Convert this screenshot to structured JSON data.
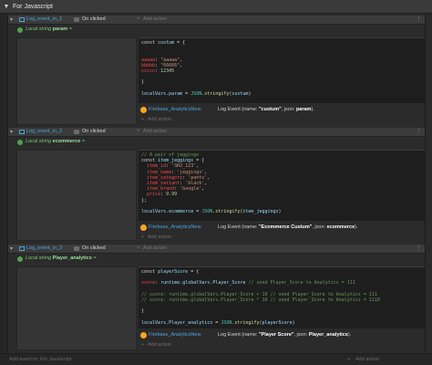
{
  "group": {
    "title": "For Javascript",
    "chevron": "▼"
  },
  "events": [
    {
      "name": "Log_event_in_1",
      "condition": "On clicked",
      "add_action": "Add action",
      "local_var": {
        "prefix": "Local string",
        "name": "param",
        "eq": "="
      },
      "code": [
        [
          [
            "kw",
            "const "
          ],
          [
            "var",
            "custum"
          ],
          [
            "kw",
            " = {"
          ]
        ],
        [
          [
            "kw",
            ""
          ]
        ],
        [
          [
            "kw",
            ""
          ]
        ],
        [
          [
            "red",
            "aaaaa"
          ],
          [
            "kw",
            ": "
          ],
          [
            "str",
            "\"aaaaa\""
          ],
          [
            "kw",
            ","
          ]
        ],
        [
          [
            "red",
            "bbbbb"
          ],
          [
            "kw",
            ": "
          ],
          [
            "str",
            "\"66666\""
          ],
          [
            "kw",
            ","
          ]
        ],
        [
          [
            "red",
            "ccccc"
          ],
          [
            "kw",
            ": "
          ],
          [
            "num",
            "12345"
          ]
        ],
        [
          [
            "kw",
            ""
          ]
        ],
        [
          [
            "kw",
            "}"
          ]
        ],
        [
          [
            "kw",
            ""
          ]
        ],
        [
          [
            "var",
            "localVars"
          ],
          [
            "kw",
            "."
          ],
          [
            "var",
            "param"
          ],
          [
            "kw",
            " = "
          ],
          [
            "prop",
            "JSON"
          ],
          [
            "kw",
            "."
          ],
          [
            "fn",
            "stringify"
          ],
          [
            "kw",
            "("
          ],
          [
            "var",
            "custum"
          ],
          [
            "kw",
            ")"
          ]
        ]
      ],
      "action": {
        "object": "Firebase_AnalyticsNew",
        "text": "Log Event (name: ",
        "bold1": "\"custum\"",
        "mid": ", json: ",
        "bold2": "param",
        "end": ")."
      },
      "add_action_bottom": "Add action"
    },
    {
      "name": "Log_event_in_2",
      "condition": "On clicked",
      "add_action": "Add action",
      "local_var": {
        "prefix": "Local string",
        "name": "ecommerce",
        "eq": "="
      },
      "code": [
        [
          [
            "cmt",
            "// A pair of jeggings"
          ]
        ],
        [
          [
            "kw",
            "const "
          ],
          [
            "var",
            "item_jeggings"
          ],
          [
            "kw",
            " = {"
          ]
        ],
        [
          [
            "kw",
            "  "
          ],
          [
            "red",
            "item_id"
          ],
          [
            "kw",
            ": "
          ],
          [
            "str",
            "'SKU_123'"
          ],
          [
            "kw",
            ","
          ]
        ],
        [
          [
            "kw",
            "  "
          ],
          [
            "red",
            "item_name"
          ],
          [
            "kw",
            ": "
          ],
          [
            "str",
            "'jeggings'"
          ],
          [
            "kw",
            ","
          ]
        ],
        [
          [
            "kw",
            "  "
          ],
          [
            "red",
            "item_category"
          ],
          [
            "kw",
            ": "
          ],
          [
            "str",
            "'pants'"
          ],
          [
            "kw",
            ","
          ]
        ],
        [
          [
            "kw",
            "  "
          ],
          [
            "red",
            "item_variant"
          ],
          [
            "kw",
            ": "
          ],
          [
            "str",
            "'black'"
          ],
          [
            "kw",
            ","
          ]
        ],
        [
          [
            "kw",
            "  "
          ],
          [
            "red",
            "item_brand"
          ],
          [
            "kw",
            ": "
          ],
          [
            "str",
            "'Google'"
          ],
          [
            "kw",
            ","
          ]
        ],
        [
          [
            "kw",
            "  "
          ],
          [
            "red",
            "price"
          ],
          [
            "kw",
            ": "
          ],
          [
            "num",
            "9.99"
          ]
        ],
        [
          [
            "kw",
            "};"
          ]
        ],
        [
          [
            "kw",
            ""
          ]
        ],
        [
          [
            "var",
            "localVars"
          ],
          [
            "kw",
            "."
          ],
          [
            "var",
            "ecommerce"
          ],
          [
            "kw",
            " = "
          ],
          [
            "prop",
            "JSON"
          ],
          [
            "kw",
            "."
          ],
          [
            "fn",
            "stringify"
          ],
          [
            "kw",
            "("
          ],
          [
            "var",
            "item_jeggings"
          ],
          [
            "kw",
            ")"
          ]
        ]
      ],
      "action": {
        "object": "Firebase_AnalyticsNew",
        "text": "Log Event (name: ",
        "bold1": "\"Ecommerce Custum\"",
        "mid": ", json: ",
        "bold2": "ecommerce",
        "end": ")."
      },
      "add_action_bottom": "Add action"
    },
    {
      "name": "Log_event_in_3",
      "condition": "On clicked",
      "add_action": "Add action",
      "local_var": {
        "prefix": "Local string",
        "name": "Player_analytics",
        "eq": "="
      },
      "code": [
        [
          [
            "kw",
            "const "
          ],
          [
            "var",
            "playerScore"
          ],
          [
            "kw",
            " = {"
          ]
        ],
        [
          [
            "kw",
            ""
          ]
        ],
        [
          [
            "red",
            "score"
          ],
          [
            "kw",
            ": "
          ],
          [
            "var",
            "runtime"
          ],
          [
            "kw",
            "."
          ],
          [
            "var",
            "globalVars"
          ],
          [
            "kw",
            "."
          ],
          [
            "var",
            "Player_Score"
          ],
          [
            "cmt",
            " // send Player_Score to Analytics = 111"
          ]
        ],
        [
          [
            "kw",
            ""
          ]
        ],
        [
          [
            "cmt",
            "// score: runtime.globalVars.Player_Score + 10 // send Player_Score to Analytics = 111"
          ]
        ],
        [
          [
            "cmt",
            "// score: runtime.globalVars.Player_Score * 10 // send Player_Score to Analytics = 1110"
          ]
        ],
        [
          [
            "kw",
            ""
          ]
        ],
        [
          [
            "kw",
            "}"
          ]
        ],
        [
          [
            "kw",
            ""
          ]
        ],
        [
          [
            "var",
            "localVars"
          ],
          [
            "kw",
            "."
          ],
          [
            "var",
            "Player_analytics"
          ],
          [
            "kw",
            " = "
          ],
          [
            "prop",
            "JSON"
          ],
          [
            "kw",
            "."
          ],
          [
            "fn",
            "stringify"
          ],
          [
            "kw",
            "("
          ],
          [
            "var",
            "playerScore"
          ],
          [
            "kw",
            ")"
          ]
        ]
      ],
      "action": {
        "object": "Firebase_AnalyticsNew",
        "text": "Log Event (name: ",
        "bold1": "\"Player Score\"",
        "mid": ", json: ",
        "bold2": "Player_analytics",
        "end": ")."
      },
      "add_action_bottom": "Add action"
    }
  ],
  "footer": {
    "add_event": "Add event to: For Javascript",
    "add_action": "Add action"
  }
}
